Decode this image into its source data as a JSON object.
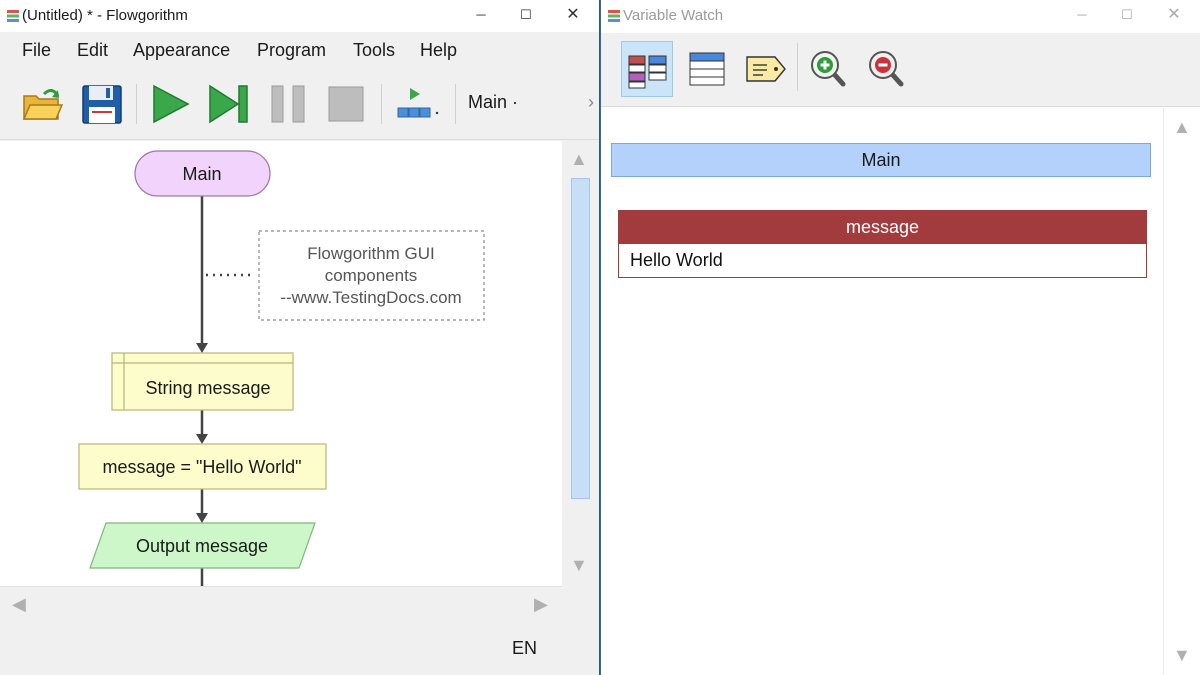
{
  "main_window": {
    "title": "(Untitled) * - Flowgorithm",
    "controls": {
      "minimize": "─",
      "maximize": "☐",
      "close": "✕"
    },
    "menu": [
      "File",
      "Edit",
      "Appearance",
      "Program",
      "Tools",
      "Help"
    ],
    "toolbar": {
      "icons": [
        "open-folder-icon",
        "save-disk-icon",
        "run-play-icon",
        "step-icon",
        "pause-icon",
        "stop-icon",
        "layout-icon"
      ],
      "function_selector": "Main ·",
      "overflow": "›"
    },
    "flowchart": {
      "start": "Main",
      "comment": [
        "Flowgorithm GUI",
        "components",
        "--www.TestingDocs.com"
      ],
      "declare": "String message",
      "assign": "message = \"Hello World\"",
      "output": "Output message"
    },
    "scroll_arrows": {
      "up": "▲",
      "down": "▼",
      "left": "◀",
      "right": "▶"
    },
    "status": {
      "language": "EN"
    }
  },
  "watch_window": {
    "title": "Variable Watch",
    "controls": {
      "minimize": "─",
      "maximize": "☐",
      "close": "✕"
    },
    "toolbar_icons": [
      "grid-view-icon",
      "list-view-icon",
      "tag-icon",
      "zoom-in-icon",
      "zoom-out-icon"
    ],
    "scope": "Main",
    "variables": [
      {
        "name": "message",
        "value": "Hello World"
      }
    ],
    "scroll_arrows": {
      "up": "▲",
      "down": "▼"
    }
  },
  "colors": {
    "start_fill": "#f2d3fb",
    "declare_fill": "#fdfdcb",
    "output_fill": "#cdf6c9",
    "scope_bar": "#b3d1fa",
    "variable_header": "#a23b3e",
    "scrollbar_thumb": "#c6dff7"
  }
}
